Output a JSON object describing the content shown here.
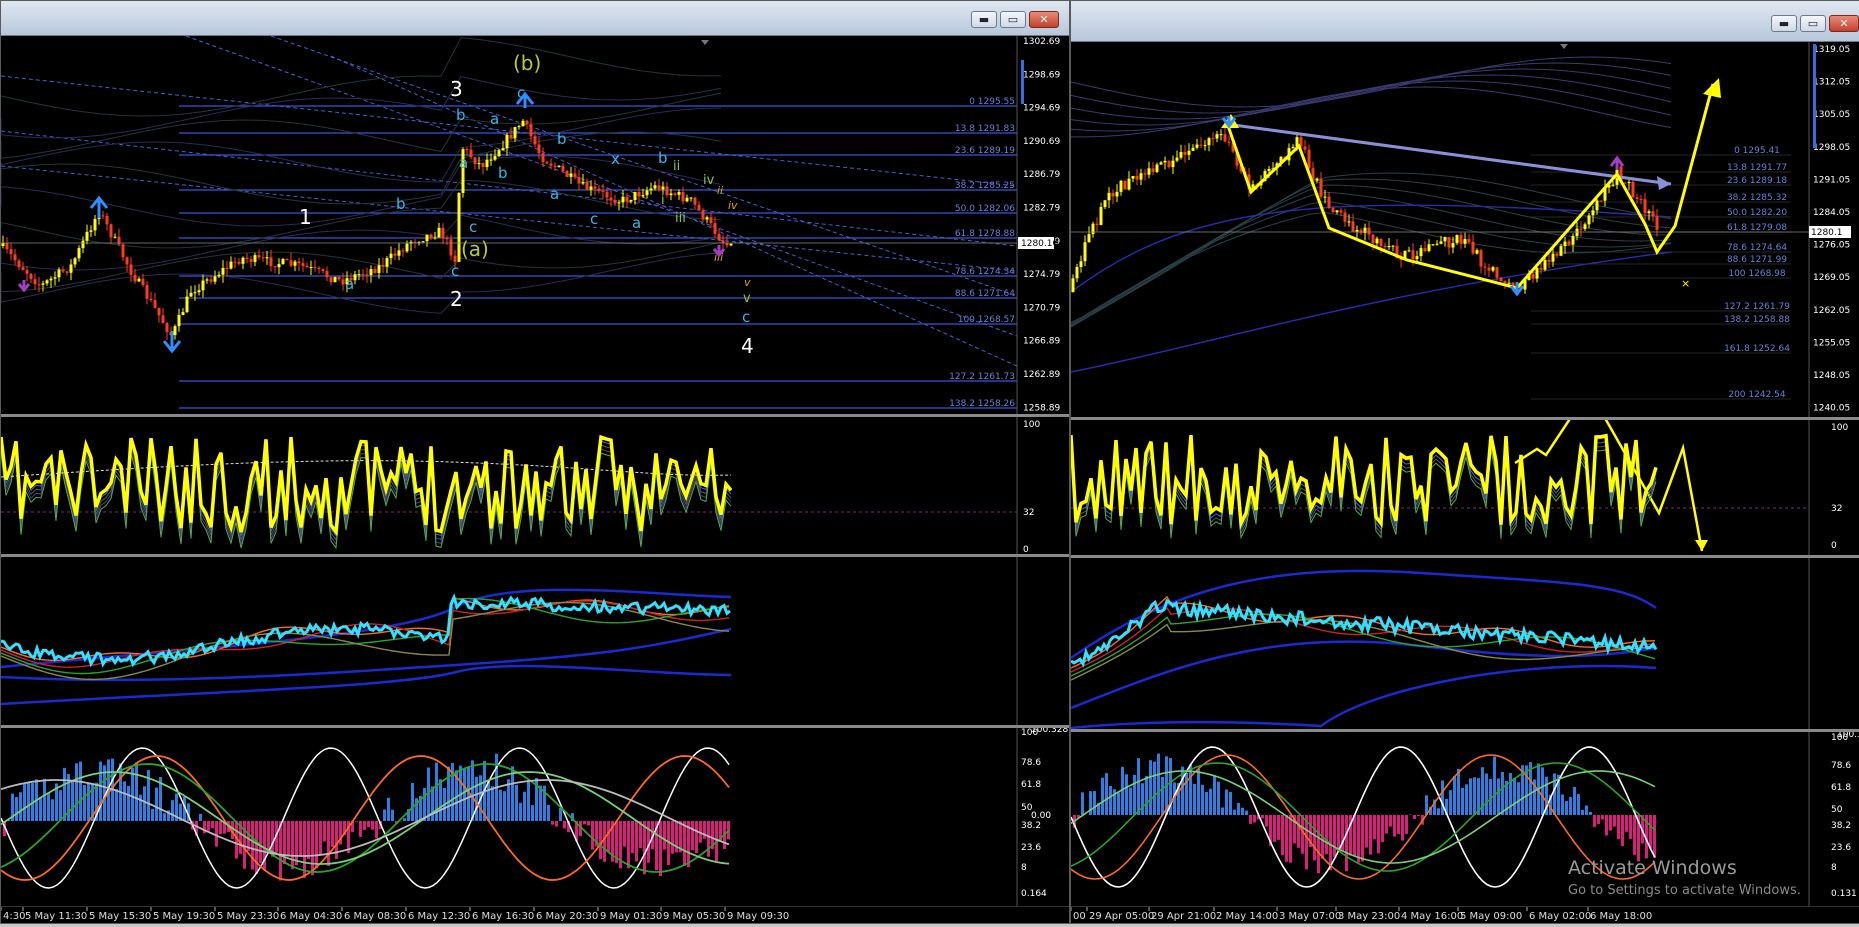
{
  "left_window": {
    "buttons": {
      "minimize": "▬",
      "restore": "▭",
      "close": "✕"
    },
    "price_axis": [
      "1302.69",
      "1298.69",
      "1294.69",
      "1290.69",
      "1286.79",
      "1282.79",
      "1278.79",
      "1274.79",
      "1270.79",
      "1266.89",
      "1262.89",
      "1258.89"
    ],
    "current_price": "1280.10",
    "fib_levels": [
      {
        "label": "0 1295.55"
      },
      {
        "label": "13.8 1291.83"
      },
      {
        "label": "23.6 1289.19"
      },
      {
        "label": "38.2 1285.25"
      },
      {
        "label": "50.0 1282.06"
      },
      {
        "label": "61.8 1278.88"
      },
      {
        "label": "78.6 1274.34"
      },
      {
        "label": "88.6 1271.64"
      },
      {
        "label": "100 1268.57"
      },
      {
        "label": "127.2 1261.73"
      },
      {
        "label": "138.2 1258.26"
      }
    ],
    "wave_labels": {
      "w1": "1",
      "w2": "2",
      "w3": "3",
      "w4": "4",
      "b_big": "(b)",
      "a_big": "(a)",
      "a": "a",
      "b": "b",
      "c": "c",
      "x": "x",
      "i": "i",
      "ii": "ii",
      "iii": "iii",
      "iv": "iv",
      "v": "v"
    },
    "osc1_axis": [
      "100",
      "32",
      "0"
    ],
    "osc3_axis": [
      "100",
      "78.6",
      "61.8",
      "50",
      "38.2",
      "23.6",
      "8",
      "0.164"
    ],
    "osc3_top": "100.328",
    "osc3_mid": "0.00",
    "x_axis": [
      "4:30",
      "5 May 11:30",
      "5 May 15:30",
      "5 May 19:30",
      "5 May 23:30",
      "6 May 04:30",
      "6 May 08:30",
      "6 May 12:30",
      "6 May 16:30",
      "6 May 20:30",
      "9 May 01:30",
      "9 May 05:30",
      "9 May 09:30"
    ]
  },
  "right_window": {
    "buttons": {
      "minimize": "▬",
      "restore": "▭",
      "close": "✕"
    },
    "price_axis": [
      "1319.05",
      "1312.05",
      "1305.05",
      "1298.05",
      "1291.05",
      "1284.05",
      "1276.05",
      "1269.05",
      "1262.05",
      "1255.05",
      "1248.05",
      "1240.05"
    ],
    "current_price": "1280.1",
    "fib_levels": [
      {
        "label": "0 1295.41"
      },
      {
        "label": "13.8 1291.77"
      },
      {
        "label": "23.6 1289.18"
      },
      {
        "label": "38.2 1285.32"
      },
      {
        "label": "50.0 1282.20"
      },
      {
        "label": "61.8 1279.08"
      },
      {
        "label": "78.6 1274.64"
      },
      {
        "label": "88.6 1271.99"
      },
      {
        "label": "100 1268.98"
      },
      {
        "label": "127.2 1261.79"
      },
      {
        "label": "138.2 1258.88"
      },
      {
        "label": "161.8 1252.64"
      },
      {
        "label": "200 1242.54"
      }
    ],
    "osc1_axis": [
      "100",
      "32",
      "0"
    ],
    "osc3_axis": [
      "100",
      "78.6",
      "61.8",
      "50",
      "38.2",
      "23.6",
      "8",
      "0.131"
    ],
    "osc3_top": "100.399",
    "x_axis": [
      "00",
      "29 Apr 05:00",
      "29 Apr 21:00",
      "2 May 14:00",
      "3 May 07:00",
      "3 May 23:00",
      "4 May 16:00",
      "5 May 09:00",
      "6 May 02:00",
      "6 May 18:00"
    ]
  },
  "watermark": {
    "title": "Activate Windows",
    "subtitle": "Go to Settings to activate Windows."
  },
  "colors": {
    "candle_up": "#ffff00",
    "candle_down": "#ff3b1f",
    "fib_line": "#3b55d8",
    "oscillator": "#ffff00",
    "osc2_main": "#33e0ff",
    "histogram_up": "#2f7fe0",
    "histogram_down": "#d8207a"
  }
}
